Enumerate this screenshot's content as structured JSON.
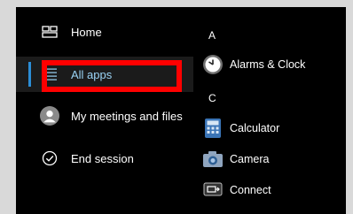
{
  "nav": {
    "items": [
      {
        "label": "Home",
        "icon": "home-icon"
      },
      {
        "label": "All apps",
        "icon": "all-apps-list-icon"
      },
      {
        "label": "My meetings and files",
        "icon": "avatar-icon"
      },
      {
        "label": "End session",
        "icon": "check-circle-icon"
      }
    ],
    "selected_index": 1
  },
  "apps": {
    "groups": [
      {
        "letter": "A",
        "items": [
          {
            "label": "Alarms & Clock",
            "icon": "clock-icon"
          }
        ]
      },
      {
        "letter": "C",
        "items": [
          {
            "label": "Calculator",
            "icon": "calculator-icon"
          },
          {
            "label": "Camera",
            "icon": "camera-icon"
          },
          {
            "label": "Connect",
            "icon": "connect-icon"
          }
        ]
      }
    ]
  },
  "colors": {
    "panel_bg": "#000000",
    "selected_text": "#9ad3f5",
    "accent": "#2b8dd6",
    "highlight_border": "#ff0000"
  }
}
